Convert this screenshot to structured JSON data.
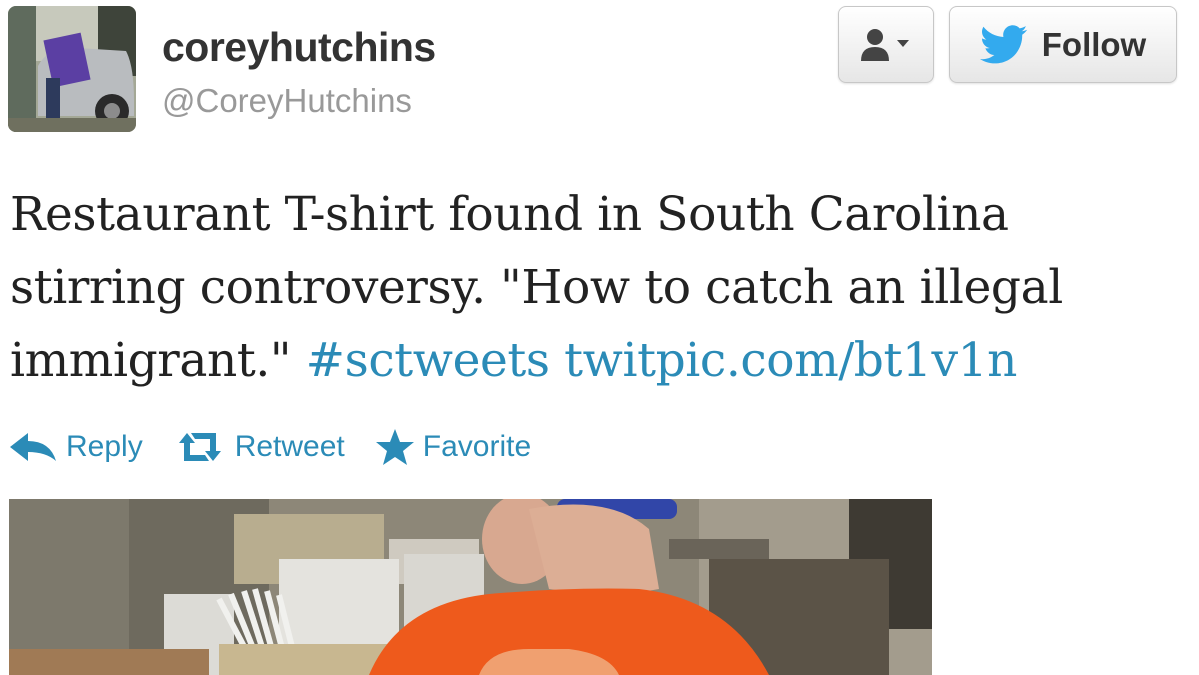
{
  "user": {
    "display_name": "coreyhutchins",
    "screen_name": "@CoreyHutchins"
  },
  "buttons": {
    "user_menu_icon": "person-dropdown-icon",
    "follow_label": "Follow",
    "follow_icon": "twitter-bird-icon"
  },
  "tweet": {
    "text_plain": "Restaurant T-shirt found in South Carolina stirring controversy. \"How to catch an illegal immigrant.\"",
    "hashtag": "#sctweets",
    "link": "twitpic.com/bt1v1n"
  },
  "actions": [
    {
      "label": "Reply",
      "icon": "reply-arrow-icon"
    },
    {
      "label": "Retweet",
      "icon": "retweet-icon"
    },
    {
      "label": "Favorite",
      "icon": "star-icon"
    }
  ],
  "colors": {
    "link": "#2b8bb7",
    "twitter_blue": "#33aaee",
    "shirt_orange": "#ee5a1c"
  }
}
